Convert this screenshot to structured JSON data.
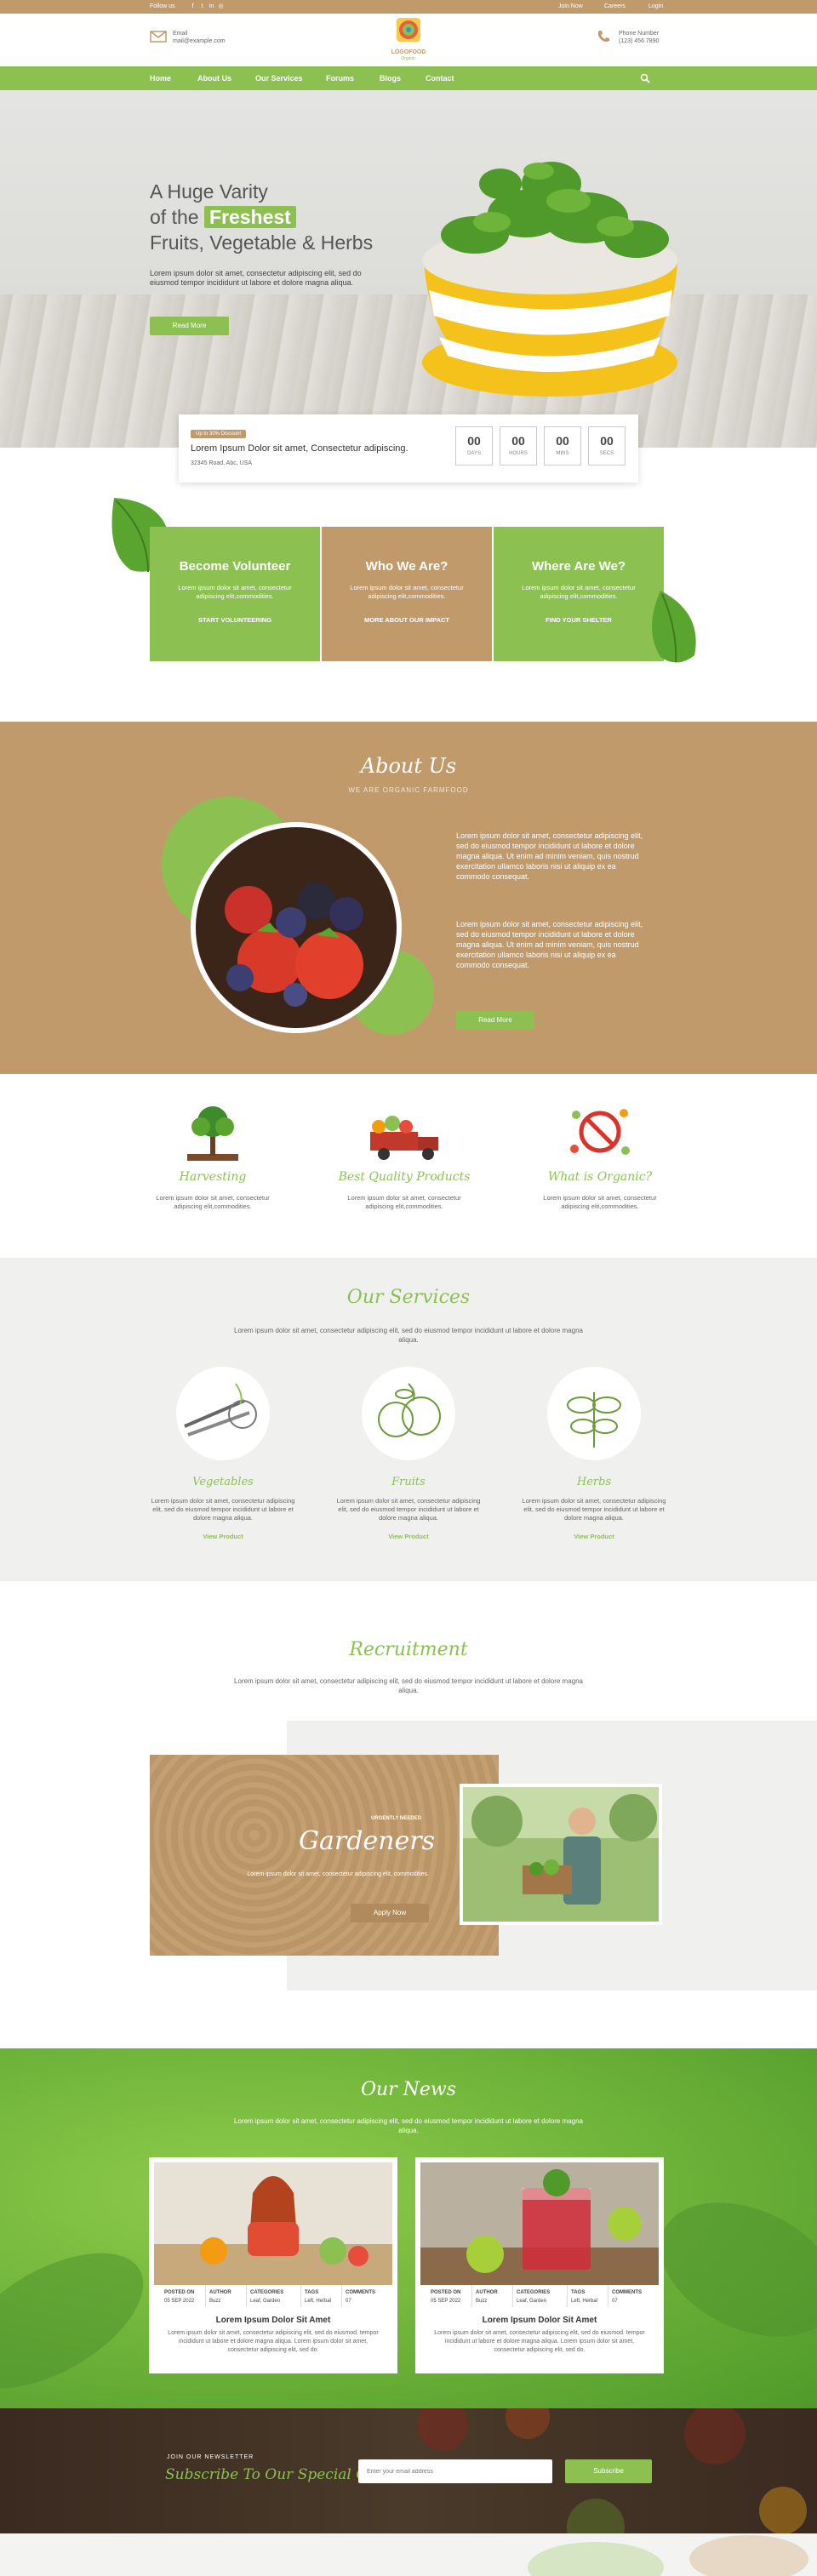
{
  "topbar": {
    "follow_label": "Follow us",
    "links": [
      "Join Now",
      "Careers",
      "Login"
    ]
  },
  "header": {
    "email_label": "Email",
    "email_value": "mail@example.com",
    "phone_label": "Phone Number",
    "phone_value": "(123) 456 7890",
    "logo_text": "LOGOFOOD",
    "logo_sub": "Organic"
  },
  "nav": {
    "items": [
      "Home",
      "About Us",
      "Our Services",
      "Forums",
      "Blogs",
      "Contact"
    ]
  },
  "hero": {
    "line1": "A Huge Varity",
    "line2_pre": "of the",
    "line2_highlight": "Freshest",
    "line3": "Fruits, Vegetable & Herbs",
    "desc": "Lorem ipsum dolor sit amet, consectetur adipiscing elit, sed do eiusmod tempor incididunt ut labore et dolore magna aliqua.",
    "button": "Read More"
  },
  "event": {
    "tag": "Up to 30% Discount",
    "title": "Lorem Ipsum Dolor sit amet, Consectetur adipiscing.",
    "address": "32345 Road, Abc, USA",
    "countdown": [
      {
        "value": "00",
        "label": "DAYS"
      },
      {
        "value": "00",
        "label": "HOURS"
      },
      {
        "value": "00",
        "label": "MINS"
      },
      {
        "value": "00",
        "label": "SECS"
      }
    ]
  },
  "features_boxes": [
    {
      "title": "Become Volunteer",
      "desc": "Lorem ipsum dolor sit amet, consectetur adipiscing elit,commodities.",
      "action": "START VOLUNTEERING"
    },
    {
      "title": "Who We Are?",
      "desc": "Lorem ipsum dolor sit amet, consectetur adipiscing elit,commodities.",
      "action": "MORE ABOUT OUR IMPACT"
    },
    {
      "title": "Where Are We?",
      "desc": "Lorem ipsum dolor sit amet, consectetur adipiscing elit,commodities.",
      "action": "FIND YOUR SHELTER"
    }
  ],
  "about": {
    "title": "About Us",
    "subtitle": "WE ARE ORGANIC FARMFOOD",
    "para1": "Lorem ipsum dolor sit amet, consectetur adipiscing elit, sed do eiusmod tempor incididunt ut labore et dolore magna aliqua. Ut enim ad minim veniam, quis nostrud exercitation ullamco laboris nisi ut aliquip ex ea commodo consequat.",
    "para2": "Lorem ipsum dolor sit amet, consectetur adipiscing elit, sed do eiusmod tempor incididunt ut labore et dolore magna aliqua. Ut enim ad minim veniam, quis nostrud exercitation ullamco laboris nisi ut aliquip ex ea commodo consequat.",
    "button": "Read More"
  },
  "features": [
    {
      "title": "Harvesting",
      "desc": "Lorem ipsum dolor sit amet, consectetur adipiscing elit,commodities."
    },
    {
      "title": "Best Quality Products",
      "desc": "Lorem ipsum dolor sit amet, consectetur adipiscing elit,commodities."
    },
    {
      "title": "What is Organic?",
      "desc": "Lorem ipsum dolor sit amet, consectetur adipiscing elit,commodities."
    }
  ],
  "services": {
    "title": "Our Services",
    "desc": "Lorem ipsum dolor sit amet, consectetur adipiscing elit, sed do eiusmod tempor incididunt ut labore et dolore magna aliqua.",
    "items": [
      {
        "title": "Vegetables",
        "desc": "Lorem ipsum dolor sit amet, consectetur adipiscing elit, sed do eiusmod tempor incididunt ut labore et dolore magna aliqua.",
        "link": "View Product"
      },
      {
        "title": "Fruits",
        "desc": "Lorem ipsum dolor sit amet, consectetur adipiscing elit, sed do eiusmod tempor incididunt ut labore et dolore magna aliqua.",
        "link": "View Product"
      },
      {
        "title": "Herbs",
        "desc": "Lorem ipsum dolor sit amet, consectetur adipiscing elit, sed do eiusmod tempor incididunt ut labore et dolore magna aliqua.",
        "link": "View Product"
      }
    ]
  },
  "recruitment": {
    "title": "Recruitment",
    "desc": "Lorem ipsum dolor sit amet, consectetur adipiscing elit, sed do eiusmod tempor incididunt ut labore et dolore magna aliqua.",
    "tag": "URGENTLY NEEDED",
    "role": "Gardeners",
    "role_desc": "Lorem ipsum dolor sit amet, consectetur adipiscing elit, commodities.",
    "button": "Apply Now"
  },
  "news": {
    "title": "Our News",
    "desc": "Lorem ipsum dolor sit amet, consectetur adipiscing elit, sed do eiusmod tempor incididunt ut labore et dolore magna aliqua.",
    "meta_headers": [
      "POSTED ON",
      "AUTHOR",
      "CATEGORIES",
      "TAGS",
      "COMMENTS"
    ],
    "cards": [
      {
        "meta": [
          "05 SEP 2022",
          "Buzz",
          "Leaf, Garden",
          "Left, Herbal",
          "07"
        ],
        "title": "Lorem Ipsum Dolor Sit Amet",
        "desc": "Lorem ipsum dolor sit amet, consectetur adipiscing elit, sed do eiusmod. tempor incididunt ut labore et dolore magna aliqua. Lorem ipsum dolor sit amet, consectetur adipiscing elit, sed do."
      },
      {
        "meta": [
          "05 SEP 2022",
          "Buzz",
          "Leaf, Garden",
          "Left, Herbal",
          "07"
        ],
        "title": "Lorem Ipsum Dolor Sit Amet",
        "desc": "Lorem ipsum dolor sit amet, consectetur adipiscing elit, sed do eiusmod. tempor incididunt ut labore et dolore magna aliqua. Lorem ipsum dolor sit amet, consectetur adipiscing elit, sed do."
      }
    ]
  },
  "newsletter": {
    "label": "JOIN OUR NEWSLETTER",
    "title": "Subscribe To Our Special Offers",
    "placeholder": "Enter your email address",
    "button": "Subscribe"
  },
  "colors": {
    "green": "#8cc152",
    "tan": "#c09a6b",
    "dark": "#3a2a20"
  }
}
